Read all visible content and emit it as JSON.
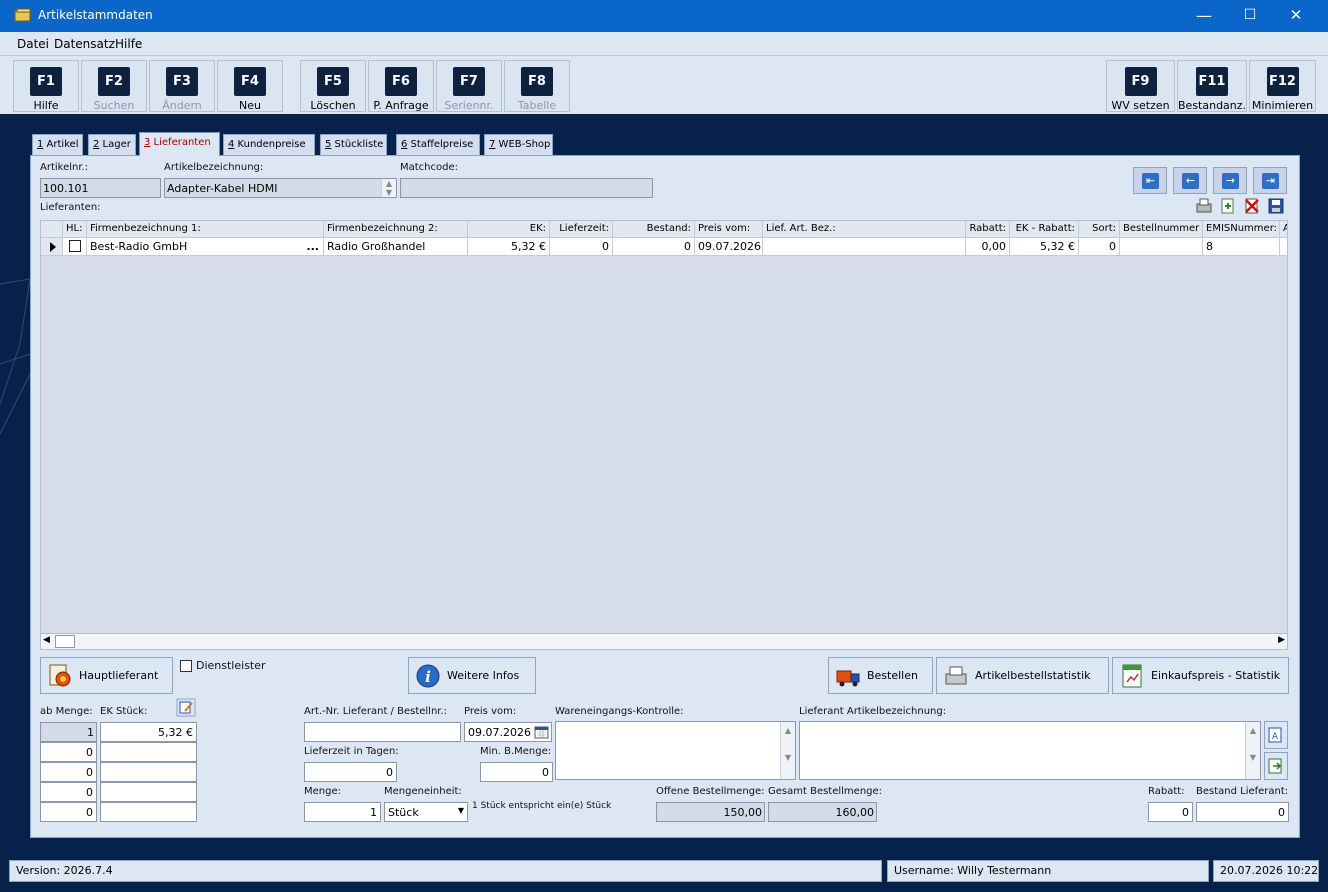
{
  "window": {
    "title": "Artikelstammdaten",
    "minimize": "—",
    "maximize": "☐",
    "close": "✕"
  },
  "menu": [
    "Datei",
    "Datensatz",
    "Hilfe"
  ],
  "fkeys": [
    {
      "key": "F1",
      "label": "Hilfe"
    },
    {
      "key": "F2",
      "label": "Suchen"
    },
    {
      "key": "F3",
      "label": "Ändern"
    },
    {
      "key": "F4",
      "label": "Neu"
    },
    {
      "key": "F5",
      "label": "Löschen"
    },
    {
      "key": "F6",
      "label": "P. Anfrage"
    },
    {
      "key": "F7",
      "label": "Seriennr."
    },
    {
      "key": "F8",
      "label": "Tabelle"
    },
    {
      "key": "F9",
      "label": "WV setzen"
    },
    {
      "key": "F11",
      "label": "Bestandanz."
    },
    {
      "key": "F12",
      "label": "Minimieren"
    }
  ],
  "tabs": [
    {
      "num": "1",
      "label": " Artikel"
    },
    {
      "num": "2",
      "label": " Lager"
    },
    {
      "num": "3",
      "label": " Lieferanten"
    },
    {
      "num": "4",
      "label": " Kundenpreise"
    },
    {
      "num": "5",
      "label": " Stückliste"
    },
    {
      "num": "6",
      "label": " Staffelpreise"
    },
    {
      "num": "7",
      "label": " WEB-Shop"
    }
  ],
  "header": {
    "artikelnr_label": "Artikelnr.:",
    "artikelnr": "100.101",
    "bez_label": "Artikelbezeichnung:",
    "bez": "Adapter-Kabel HDMI",
    "matchcode_label": "Matchcode:",
    "matchcode": ""
  },
  "lieferanten_label": "Lieferanten:",
  "grid": {
    "columns": [
      "HL:",
      "Firmenbezeichnung 1:",
      "Firmenbezeichnung 2:",
      "EK:",
      "Lieferzeit:",
      "Bestand:",
      "Preis vom:",
      "Lief. Art. Bez.:",
      "Rabatt:",
      "EK - Rabatt:",
      "Sort:",
      "Bestellnummer",
      "EMISNummer:",
      "A"
    ],
    "row": {
      "firma1": "Best-Radio GmbH",
      "dots": "...",
      "firma2": "Radio Großhandel",
      "ek": "5,32 €",
      "lieferzeit": "0",
      "bestand": "0",
      "preis_vom": "09.07.2026",
      "lief_art_bez": "",
      "rabatt": "0,00",
      "ek_rabatt": "5,32 €",
      "sort": "0",
      "bestellnummer": "",
      "emis": "8"
    }
  },
  "buttons": {
    "hauptlieferant": "Hauptlieferant",
    "dienstleister": "Dienstleister",
    "weitere_infos": "Weitere Infos",
    "bestellen": "Bestellen",
    "artikelbestellstatistik": "Artikelbestellstatistik",
    "einkaufspreis_statistik": "Einkaufspreis - Statistik"
  },
  "staffel": {
    "ab_menge_label": "ab Menge:",
    "ek_stueck_label": "EK Stück:",
    "rows": [
      {
        "menge": "1",
        "ek": "5,32 €"
      },
      {
        "menge": "0",
        "ek": ""
      },
      {
        "menge": "0",
        "ek": ""
      },
      {
        "menge": "0",
        "ek": ""
      },
      {
        "menge": "0",
        "ek": ""
      }
    ]
  },
  "details": {
    "artnr_label": "Art.-Nr. Lieferant / Bestellnr.:",
    "artnr": "",
    "preis_vom_label": "Preis vom:",
    "preis_vom": "09.07.2026",
    "wareneingang_label": "Wareneingangs-Kontrolle:",
    "wareneingang": "",
    "lief_bez_label": "Lieferant Artikelbezeichnung:",
    "lief_bez": "",
    "lieferzeit_label": "Lieferzeit in Tagen:",
    "lieferzeit": "0",
    "min_menge_label": "Min. B.Menge:",
    "min_menge": "0",
    "menge_label": "Menge:",
    "menge": "1",
    "einheit_label": "Mengeneinheit:",
    "einheit": "Stück",
    "einheit_info": "1 Stück entspricht ein(e) Stück",
    "offene_label": "Offene Bestellmenge:",
    "offene": "150,00",
    "gesamt_label": "Gesamt Bestellmenge:",
    "gesamt": "160,00",
    "rabatt_label": "Rabatt:",
    "rabatt": "0",
    "bestand_label": "Bestand Lieferant:",
    "bestand": "0"
  },
  "status": {
    "version": "Version: 2026.7.4",
    "user": "Username: Willy Testermann",
    "datetime": "20.07.2026 10:22"
  }
}
